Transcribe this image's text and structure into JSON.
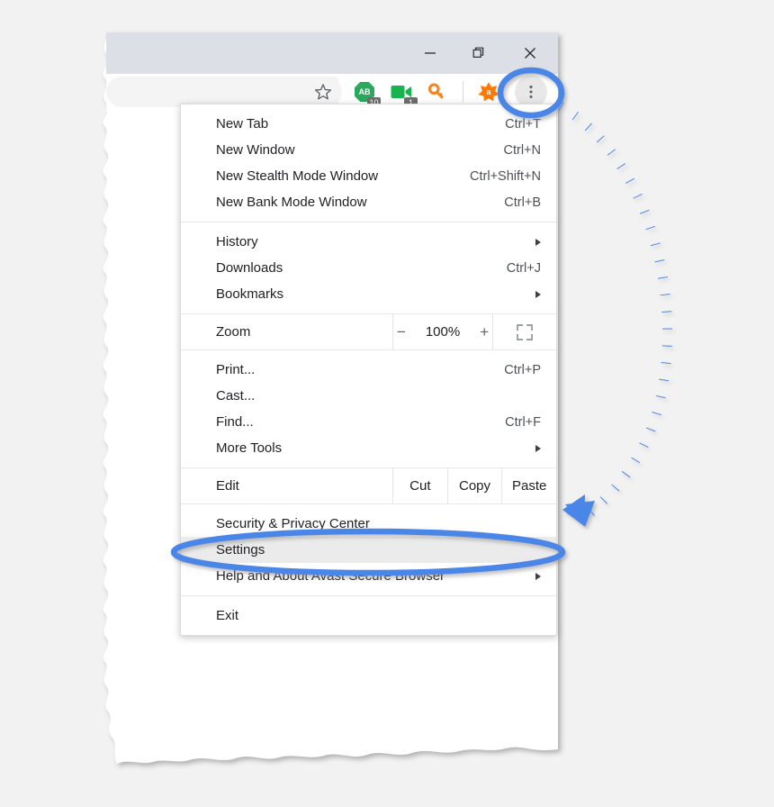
{
  "window": {
    "titlebar_color": "#dcdfe5",
    "controls": [
      {
        "name": "minimize",
        "glyph": "—"
      },
      {
        "name": "restore",
        "glyph": "❐"
      },
      {
        "name": "close",
        "glyph": "✕"
      }
    ]
  },
  "toolbar": {
    "omnibox_value": "",
    "omnibox_placeholder": "",
    "icons": [
      {
        "name": "bookmark-star-icon",
        "label": "☆"
      },
      {
        "name": "adblock-icon",
        "label": "AB",
        "badge": "10",
        "color": "#29a25a"
      },
      {
        "name": "video-downloader-icon",
        "label": "",
        "badge": "1",
        "color": "#17b44e"
      },
      {
        "name": "password-key-icon",
        "label": "",
        "color": "#f07b17"
      },
      {
        "name": "avast-logo-icon",
        "label": "a",
        "color": "#ff7800"
      },
      {
        "name": "chrome-menu-icon",
        "label": "⋮",
        "color": "#5f6368"
      }
    ]
  },
  "menu": {
    "groups": [
      {
        "type": "list",
        "items": [
          {
            "label": "New Tab",
            "accel": "Ctrl+T",
            "submenu": false
          },
          {
            "label": "New Window",
            "accel": "Ctrl+N",
            "submenu": false
          },
          {
            "label": "New Stealth Mode Window",
            "accel": "Ctrl+Shift+N",
            "submenu": false
          },
          {
            "label": "New Bank Mode Window",
            "accel": "Ctrl+B",
            "submenu": false
          }
        ]
      },
      {
        "type": "list",
        "items": [
          {
            "label": "History",
            "accel": "",
            "submenu": true
          },
          {
            "label": "Downloads",
            "accel": "Ctrl+J",
            "submenu": false
          },
          {
            "label": "Bookmarks",
            "accel": "",
            "submenu": true
          }
        ]
      },
      {
        "type": "zoom",
        "label": "Zoom",
        "minus": "−",
        "level": "100%",
        "plus": "+",
        "fullscreen_icon": "fullscreen-icon"
      },
      {
        "type": "list",
        "items": [
          {
            "label": "Print...",
            "accel": "Ctrl+P",
            "submenu": false
          },
          {
            "label": "Cast...",
            "accel": "",
            "submenu": false
          },
          {
            "label": "Find...",
            "accel": "Ctrl+F",
            "submenu": false
          },
          {
            "label": "More Tools",
            "accel": "",
            "submenu": true
          }
        ]
      },
      {
        "type": "edit",
        "label": "Edit",
        "buttons": [
          "Cut",
          "Copy",
          "Paste"
        ]
      },
      {
        "type": "list",
        "items": [
          {
            "label": "Security & Privacy Center",
            "accel": "",
            "submenu": false
          },
          {
            "label": "Settings",
            "accel": "",
            "submenu": false,
            "highlighted": true
          },
          {
            "label": "Help and About Avast Secure Browser",
            "accel": "",
            "submenu": true
          }
        ]
      },
      {
        "type": "list",
        "items": [
          {
            "label": "Exit",
            "accel": "",
            "submenu": false
          }
        ]
      }
    ]
  },
  "annotations": {
    "highlight_color": "#4a86e8",
    "menu_button_circle": "ellipse around three-dot menu button",
    "settings_circle": "ellipse around Settings menu item",
    "arrow": "dotted curved arrow from menu button to Settings"
  }
}
